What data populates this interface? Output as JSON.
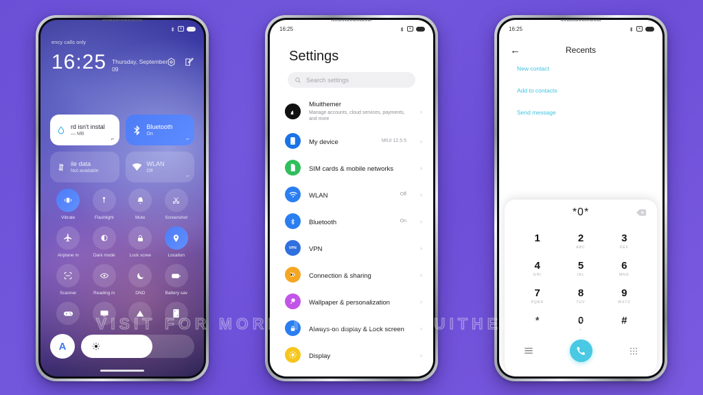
{
  "background": {
    "accent": "#6f53da",
    "watermark": "VISIT FOR MORE THEMES - MIUITHEMER.COM"
  },
  "phone1": {
    "status": {
      "time_hidden": "",
      "carrier": "ency calls only"
    },
    "lockscreen": {
      "clock": "16:25",
      "date": "Thursday, September 09"
    },
    "quick_tiles_large": [
      {
        "title": "rd isn't instal",
        "subtitle": "— MB",
        "state": "white",
        "icon": "water-drop-icon"
      },
      {
        "title": "Bluetooth",
        "subtitle": "On",
        "state": "on",
        "icon": "bluetooth-icon"
      },
      {
        "title": "ile data",
        "subtitle": "Not available",
        "state": "off",
        "icon": "mobile-data-icon"
      },
      {
        "title": "WLAN",
        "subtitle": "Off",
        "state": "off",
        "icon": "wifi-icon"
      }
    ],
    "quick_tiles": [
      {
        "label": "Vibrate",
        "icon": "vibrate-icon",
        "active": true
      },
      {
        "label": "Flashlight",
        "icon": "flashlight-icon",
        "active": false
      },
      {
        "label": "Mute",
        "icon": "bell-icon",
        "active": false
      },
      {
        "label": "Screenshot",
        "icon": "scissors-icon",
        "active": false
      },
      {
        "label": "Airplane m",
        "icon": "airplane-icon",
        "active": false
      },
      {
        "label": "Dark mode",
        "icon": "dark-mode-icon",
        "active": false
      },
      {
        "label": "Lock scree",
        "icon": "lock-icon",
        "active": false
      },
      {
        "label": "Location",
        "icon": "location-pin-icon",
        "active": true
      },
      {
        "label": "Scanner",
        "icon": "scanner-icon",
        "active": false
      },
      {
        "label": "Reading m",
        "icon": "eye-icon",
        "active": false
      },
      {
        "label": "DND",
        "icon": "moon-icon",
        "active": false
      },
      {
        "label": "Battery sav",
        "icon": "battery-saver-icon",
        "active": false
      },
      {
        "label": "",
        "icon": "game-turbo-icon",
        "active": false
      },
      {
        "label": "",
        "icon": "cast-icon",
        "active": false
      },
      {
        "label": "",
        "icon": "ultra-battery-icon",
        "active": false
      },
      {
        "label": "",
        "icon": "second-space-icon",
        "active": false
      }
    ],
    "brightness": {
      "auto_label": "A",
      "fill_percent": 63
    }
  },
  "phone2": {
    "status": {
      "time": "16:25"
    },
    "title": "Settings",
    "search": {
      "placeholder": "Search settings"
    },
    "items": [
      {
        "name": "Miuithemer",
        "desc": "Manage accounts, cloud services, payments, and more",
        "value": "",
        "icon": "account-avatar-icon",
        "color": "#111111"
      },
      {
        "name": "My device",
        "desc": "",
        "value": "MIUI 12.5.5",
        "icon": "phone-device-icon",
        "color": "#1a73e8"
      },
      {
        "name": "SIM cards & mobile networks",
        "desc": "",
        "value": "",
        "icon": "sim-card-icon",
        "color": "#2fbf5c"
      },
      {
        "name": "WLAN",
        "desc": "",
        "value": "Off",
        "icon": "wifi-icon",
        "color": "#2a7ef0"
      },
      {
        "name": "Bluetooth",
        "desc": "",
        "value": "On",
        "icon": "bluetooth-icon",
        "color": "#2a7ef0"
      },
      {
        "name": "VPN",
        "desc": "",
        "value": "",
        "icon": "vpn-icon",
        "color": "#2f6fe0"
      },
      {
        "name": "Connection & sharing",
        "desc": "",
        "value": "",
        "icon": "connection-sharing-icon",
        "color": "#f5a623"
      },
      {
        "name": "Wallpaper & personalization",
        "desc": "",
        "value": "",
        "icon": "wallpaper-brush-icon",
        "color": "#c254e8"
      },
      {
        "name": "Always-on display & Lock screen",
        "desc": "",
        "value": "",
        "icon": "lock-icon",
        "color": "#2a7ef0"
      },
      {
        "name": "Display",
        "desc": "",
        "value": "",
        "icon": "brightness-icon",
        "color": "#f7c61c"
      }
    ]
  },
  "phone3": {
    "status": {
      "time": "16:25"
    },
    "header": {
      "title": "Recents",
      "back": "←"
    },
    "links": [
      "New contact",
      "Add to contacts",
      "Send message"
    ],
    "dialer": {
      "number": "*0*",
      "keys": [
        {
          "digit": "1",
          "letters": ""
        },
        {
          "digit": "2",
          "letters": "ABC"
        },
        {
          "digit": "3",
          "letters": "DEF"
        },
        {
          "digit": "4",
          "letters": "GHI"
        },
        {
          "digit": "5",
          "letters": "JKL"
        },
        {
          "digit": "6",
          "letters": "MNO"
        },
        {
          "digit": "7",
          "letters": "PQRS"
        },
        {
          "digit": "8",
          "letters": "TUV"
        },
        {
          "digit": "9",
          "letters": "WXYZ"
        },
        {
          "digit": "*",
          "letters": ""
        },
        {
          "digit": "0",
          "letters": "+"
        },
        {
          "digit": "#",
          "letters": ""
        }
      ],
      "call_color": "#49c9e3"
    }
  }
}
